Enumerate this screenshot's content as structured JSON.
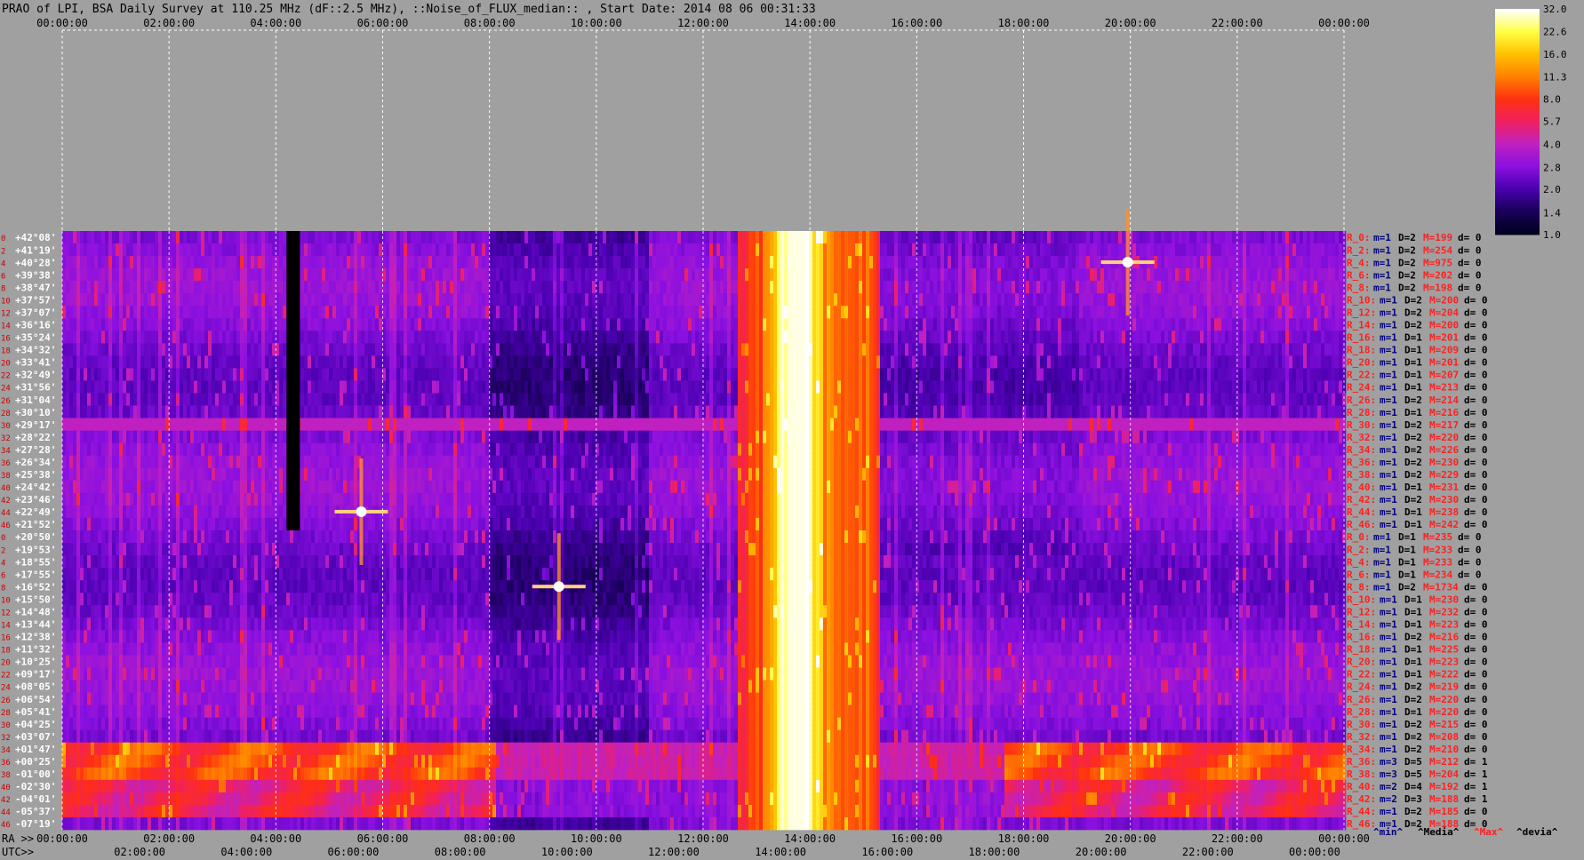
{
  "title": "PRAO of LPI, BSA Daily Survey at 110.25 MHz (dF::2.5 MHz), ::Noise_of_FLUX_median:: , Start Date: 2014 08 06 00:31:33",
  "colors": {
    "background": "#a0a0a0",
    "axis_text": "#000000",
    "dec_label": "#ffffff",
    "row_index": "#cc0000",
    "stat_red": "#ff2020",
    "stat_blue": "#000080",
    "grid": "#ffffff"
  },
  "top_time_ticks": [
    "00:00:00",
    "02:00:00",
    "04:00:00",
    "06:00:00",
    "08:00:00",
    "10:00:00",
    "12:00:00",
    "14:00:00",
    "16:00:00",
    "18:00:00",
    "20:00:00",
    "22:00:00",
    "00:00:00"
  ],
  "ra_label": "RA >>",
  "ra_ticks": [
    "00:00:00",
    "02:00:00",
    "04:00:00",
    "06:00:00",
    "08:00:00",
    "10:00:00",
    "12:00:00",
    "14:00:00",
    "16:00:00",
    "18:00:00",
    "20:00:00",
    "22:00:00",
    "00:00:00"
  ],
  "utc_label": "UTC>>",
  "utc_ticks": [
    "02:00:00",
    "04:00:00",
    "06:00:00",
    "08:00:00",
    "10:00:00",
    "12:00:00",
    "14:00:00",
    "16:00:00",
    "18:00:00",
    "20:00:00",
    "22:00:00",
    "00:00:00"
  ],
  "legend_footer": [
    "^min^",
    "^Media^",
    "^Max^",
    "^devia^"
  ],
  "colorbar_ticks": [
    "32.0",
    "22.6",
    "16.0",
    "11.3",
    "8.0",
    "5.7",
    "4.0",
    "2.8",
    "2.0",
    "1.4",
    "1.0"
  ],
  "row_indices": [
    "0",
    "2",
    "4",
    "6",
    "8",
    "10",
    "12",
    "14",
    "16",
    "18",
    "20",
    "22",
    "24",
    "26",
    "28",
    "30",
    "32",
    "34",
    "36",
    "38",
    "40",
    "42",
    "44",
    "46",
    "0",
    "2",
    "4",
    "6",
    "8",
    "10",
    "12",
    "14",
    "16",
    "18",
    "20",
    "22",
    "24",
    "26",
    "28",
    "30",
    "32",
    "34",
    "36",
    "38",
    "40",
    "42",
    "44",
    "46"
  ],
  "dec_labels": [
    "+42°08'",
    "+41°19'",
    "+40°28'",
    "+39°38'",
    "+38°47'",
    "+37°57'",
    "+37°07'",
    "+36°16'",
    "+35°24'",
    "+34°32'",
    "+33°41'",
    "+32°49'",
    "+31°56'",
    "+31°04'",
    "+30°10'",
    "+29°17'",
    "+28°22'",
    "+27°28'",
    "+26°34'",
    "+25°38'",
    "+24°42'",
    "+23°46'",
    "+22°49'",
    "+21°52'",
    "+20°50'",
    "+19°53'",
    "+18°55'",
    "+17°55'",
    "+16°52'",
    "+15°50'",
    "+14°48'",
    "+13°44'",
    "+12°38'",
    "+11°32'",
    "+10°25'",
    "+09°17'",
    "+08°05'",
    "+06°54'",
    "+05°41'",
    "+04°25'",
    "+03°07'",
    "+01°47'",
    "+00°25'",
    "-01°00'",
    "-02°30'",
    "-04°01'",
    "-05°37'",
    "-07°19'"
  ],
  "beam_stats": [
    {
      "name": "R_0:",
      "min": "m=1",
      "med": "D=2",
      "max": "M=199",
      "dev": "d= 0"
    },
    {
      "name": "R_2:",
      "min": "m=1",
      "med": "D=2",
      "max": "M=254",
      "dev": "d= 0"
    },
    {
      "name": "R_4:",
      "min": "m=1",
      "med": "D=2",
      "max": "M=975",
      "dev": "d= 0"
    },
    {
      "name": "R_6:",
      "min": "m=1",
      "med": "D=2",
      "max": "M=202",
      "dev": "d= 0"
    },
    {
      "name": "R_8:",
      "min": "m=1",
      "med": "D=2",
      "max": "M=198",
      "dev": "d= 0"
    },
    {
      "name": "R_10:",
      "min": "m=1",
      "med": "D=2",
      "max": "M=200",
      "dev": "d= 0"
    },
    {
      "name": "R_12:",
      "min": "m=1",
      "med": "D=2",
      "max": "M=204",
      "dev": "d= 0"
    },
    {
      "name": "R_14:",
      "min": "m=1",
      "med": "D=2",
      "max": "M=200",
      "dev": "d= 0"
    },
    {
      "name": "R_16:",
      "min": "m=1",
      "med": "D=1",
      "max": "M=201",
      "dev": "d= 0"
    },
    {
      "name": "R_18:",
      "min": "m=1",
      "med": "D=1",
      "max": "M=209",
      "dev": "d= 0"
    },
    {
      "name": "R_20:",
      "min": "m=1",
      "med": "D=1",
      "max": "M=201",
      "dev": "d= 0"
    },
    {
      "name": "R_22:",
      "min": "m=1",
      "med": "D=1",
      "max": "M=207",
      "dev": "d= 0"
    },
    {
      "name": "R_24:",
      "min": "m=1",
      "med": "D=1",
      "max": "M=213",
      "dev": "d= 0"
    },
    {
      "name": "R_26:",
      "min": "m=1",
      "med": "D=2",
      "max": "M=214",
      "dev": "d= 0"
    },
    {
      "name": "R_28:",
      "min": "m=1",
      "med": "D=1",
      "max": "M=216",
      "dev": "d= 0"
    },
    {
      "name": "R_30:",
      "min": "m=1",
      "med": "D=2",
      "max": "M=217",
      "dev": "d= 0"
    },
    {
      "name": "R_32:",
      "min": "m=1",
      "med": "D=2",
      "max": "M=220",
      "dev": "d= 0"
    },
    {
      "name": "R_34:",
      "min": "m=1",
      "med": "D=2",
      "max": "M=226",
      "dev": "d= 0"
    },
    {
      "name": "R_36:",
      "min": "m=1",
      "med": "D=2",
      "max": "M=230",
      "dev": "d= 0"
    },
    {
      "name": "R_38:",
      "min": "m=1",
      "med": "D=2",
      "max": "M=229",
      "dev": "d= 0"
    },
    {
      "name": "R_40:",
      "min": "m=1",
      "med": "D=1",
      "max": "M=231",
      "dev": "d= 0"
    },
    {
      "name": "R_42:",
      "min": "m=1",
      "med": "D=2",
      "max": "M=230",
      "dev": "d= 0"
    },
    {
      "name": "R_44:",
      "min": "m=1",
      "med": "D=1",
      "max": "M=238",
      "dev": "d= 0"
    },
    {
      "name": "R_46:",
      "min": "m=1",
      "med": "D=1",
      "max": "M=242",
      "dev": "d= 0"
    },
    {
      "name": "R_0:",
      "min": "m=1",
      "med": "D=1",
      "max": "M=235",
      "dev": "d= 0"
    },
    {
      "name": "R_2:",
      "min": "m=1",
      "med": "D=1",
      "max": "M=233",
      "dev": "d= 0"
    },
    {
      "name": "R_4:",
      "min": "m=1",
      "med": "D=1",
      "max": "M=233",
      "dev": "d= 0"
    },
    {
      "name": "R_6:",
      "min": "m=1",
      "med": "D=1",
      "max": "M=234",
      "dev": "d= 0"
    },
    {
      "name": "R_8:",
      "min": "m=1",
      "med": "D=2",
      "max": "M=1734",
      "dev": "d= 0"
    },
    {
      "name": "R_10:",
      "min": "m=1",
      "med": "D=1",
      "max": "M=230",
      "dev": "d= 0"
    },
    {
      "name": "R_12:",
      "min": "m=1",
      "med": "D=1",
      "max": "M=232",
      "dev": "d= 0"
    },
    {
      "name": "R_14:",
      "min": "m=1",
      "med": "D=1",
      "max": "M=223",
      "dev": "d= 0"
    },
    {
      "name": "R_16:",
      "min": "m=1",
      "med": "D=2",
      "max": "M=216",
      "dev": "d= 0"
    },
    {
      "name": "R_18:",
      "min": "m=1",
      "med": "D=1",
      "max": "M=225",
      "dev": "d= 0"
    },
    {
      "name": "R_20:",
      "min": "m=1",
      "med": "D=1",
      "max": "M=223",
      "dev": "d= 0"
    },
    {
      "name": "R_22:",
      "min": "m=1",
      "med": "D=1",
      "max": "M=222",
      "dev": "d= 0"
    },
    {
      "name": "R_24:",
      "min": "m=1",
      "med": "D=2",
      "max": "M=219",
      "dev": "d= 0"
    },
    {
      "name": "R_26:",
      "min": "m=1",
      "med": "D=2",
      "max": "M=220",
      "dev": "d= 0"
    },
    {
      "name": "R_28:",
      "min": "m=1",
      "med": "D=1",
      "max": "M=220",
      "dev": "d= 0"
    },
    {
      "name": "R_30:",
      "min": "m=1",
      "med": "D=2",
      "max": "M=215",
      "dev": "d= 0"
    },
    {
      "name": "R_32:",
      "min": "m=1",
      "med": "D=2",
      "max": "M=208",
      "dev": "d= 0"
    },
    {
      "name": "R_34:",
      "min": "m=1",
      "med": "D=2",
      "max": "M=210",
      "dev": "d= 0"
    },
    {
      "name": "R_36:",
      "min": "m=3",
      "med": "D=5",
      "max": "M=212",
      "dev": "d= 1"
    },
    {
      "name": "R_38:",
      "min": "m=3",
      "med": "D=5",
      "max": "M=204",
      "dev": "d= 1"
    },
    {
      "name": "R_40:",
      "min": "m=2",
      "med": "D=4",
      "max": "M=192",
      "dev": "d= 1"
    },
    {
      "name": "R_42:",
      "min": "m=2",
      "med": "D=3",
      "max": "M=188",
      "dev": "d= 1"
    },
    {
      "name": "R_44:",
      "min": "m=1",
      "med": "D=2",
      "max": "M=185",
      "dev": "d= 0"
    },
    {
      "name": "R_46:",
      "min": "m=1",
      "med": "D=2",
      "max": "M=188",
      "dev": "d= 0"
    }
  ],
  "chart_data": {
    "type": "heatmap",
    "title": "PRAO of LPI, BSA Daily Survey at 110.25 MHz (dF::2.5 MHz), ::Noise_of_FLUX_median:: , Start Date: 2014 08 06 00:31:33",
    "x_axis": "RA / UTC, 00:00:00 to 24:00:00",
    "y_axis": "48 BSA beams, declination +42°08' to -07°19'",
    "color_scale": {
      "min": 1.0,
      "max": 32.0,
      "scale": "log",
      "ticks": [
        32.0,
        22.6,
        16.0,
        11.3,
        8.0,
        5.7,
        4.0,
        2.8,
        2.0,
        1.4,
        1.0
      ]
    },
    "colormap": [
      "#000020",
      "#180058",
      "#4a00b0",
      "#8a10e0",
      "#c020c0",
      "#f02060",
      "#ff3010",
      "#ff8000",
      "#ffc000",
      "#ffff40",
      "#ffffff"
    ],
    "features": [
      {
        "kind": "bright band (RA)",
        "ra_hours": [
          12.6,
          15.3
        ],
        "peak_ra_hours": [
          13.6,
          13.9
        ],
        "rows": "all"
      },
      {
        "kind": "bright band (rows)",
        "ra_hours": [
          0.0,
          24.0
        ],
        "rows": [
          41,
          47
        ]
      },
      {
        "kind": "horizontal line",
        "row": 15,
        "ra_hours": [
          0.0,
          24.0
        ]
      },
      {
        "kind": "dark gap",
        "ra_hours": [
          4.2,
          4.45
        ],
        "rows": [
          0,
          23
        ]
      },
      {
        "kind": "point source",
        "ra_hours": 9.3,
        "row": 28
      },
      {
        "kind": "point source",
        "ra_hours": 19.95,
        "row": 2
      },
      {
        "kind": "point source",
        "ra_hours": 5.6,
        "row": 22
      }
    ]
  }
}
